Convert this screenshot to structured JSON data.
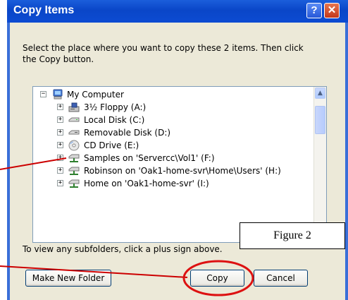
{
  "window": {
    "title": "Copy Items",
    "help_glyph": "?",
    "close_glyph": "✕"
  },
  "message": "Select the place where you want to copy these 2 items. Then click the Copy button.",
  "tree": {
    "root": {
      "label": "My Computer",
      "icon": "computer-icon",
      "expander": "−"
    },
    "items": [
      {
        "label": "3½ Floppy (A:)",
        "icon": "floppy-drive-icon",
        "expander": "+"
      },
      {
        "label": "Local Disk (C:)",
        "icon": "hard-disk-icon",
        "expander": "+"
      },
      {
        "label": "Removable Disk (D:)",
        "icon": "removable-disk-icon",
        "expander": "+"
      },
      {
        "label": "CD Drive (E:)",
        "icon": "cd-drive-icon",
        "expander": "+"
      },
      {
        "label": "Samples on 'Servercc\\Vol1' (F:)",
        "icon": "network-drive-icon",
        "expander": "+"
      },
      {
        "label": "Robinson on 'Oak1-home-svr\\Home\\Users' (H:)",
        "icon": "network-drive-icon",
        "expander": "+"
      },
      {
        "label": "Home on 'Oak1-home-svr' (I:)",
        "icon": "network-drive-icon",
        "expander": "+"
      }
    ],
    "scroll_up": "▲",
    "scroll_down": "▼"
  },
  "hint": "To view any subfolders, click a plus sign above.",
  "buttons": {
    "make_new_folder": "Make New Folder",
    "copy": "Copy",
    "cancel": "Cancel"
  },
  "annotation": {
    "figure_label": "Figure 2",
    "line_color": "#cc0000"
  }
}
